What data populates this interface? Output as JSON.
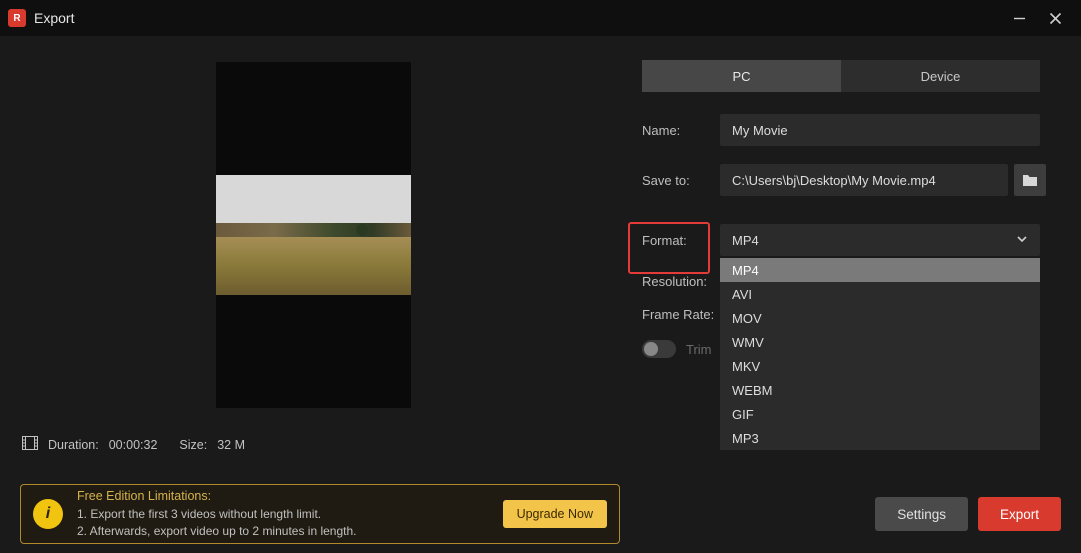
{
  "window": {
    "title": "Export",
    "logo_letter": "R"
  },
  "tabs": {
    "pc": "PC",
    "device": "Device"
  },
  "form": {
    "name_label": "Name:",
    "name_value": "My Movie",
    "saveto_label": "Save to:",
    "saveto_value": "C:\\Users\\bj\\Desktop\\My Movie.mp4",
    "format_label": "Format:",
    "format_selected": "MP4",
    "format_options": [
      "MP4",
      "AVI",
      "MOV",
      "WMV",
      "MKV",
      "WEBM",
      "GIF",
      "MP3"
    ],
    "resolution_label": "Resolution:",
    "framerate_label": "Frame Rate:",
    "trim_label": "Trim"
  },
  "meta": {
    "duration_label": "Duration:",
    "duration_value": "00:00:32",
    "size_label": "Size:",
    "size_value": "32 M"
  },
  "limitations": {
    "title": "Free Edition Limitations:",
    "line1": "1. Export the first 3 videos without length limit.",
    "line2": "2. Afterwards, export video up to 2 minutes in length.",
    "upgrade": "Upgrade Now",
    "icon_char": "i"
  },
  "footer": {
    "settings": "Settings",
    "export": "Export"
  }
}
